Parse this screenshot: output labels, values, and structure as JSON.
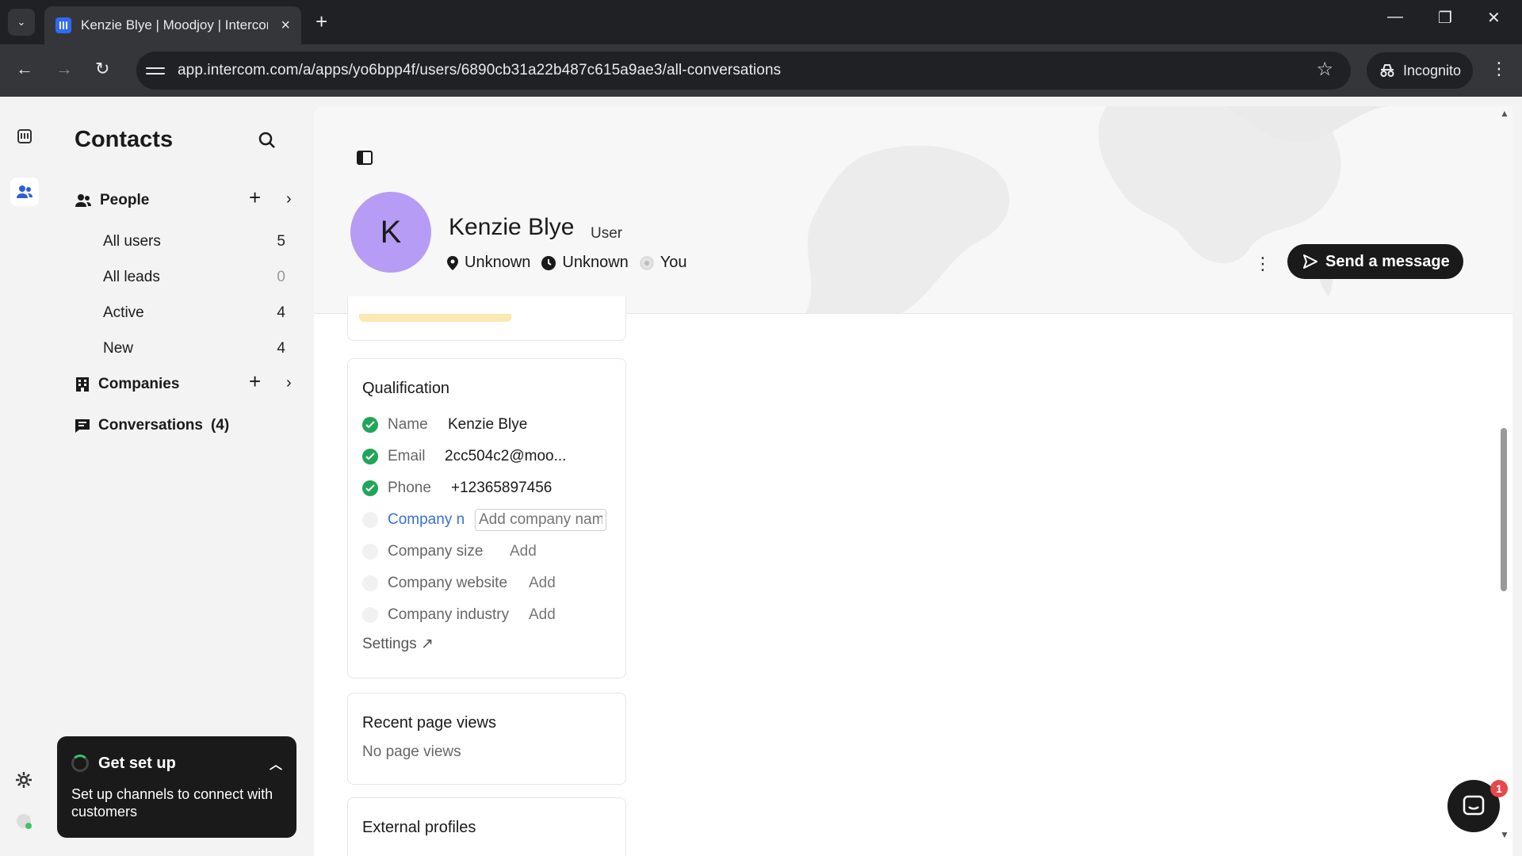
{
  "browser": {
    "tab_title": "Kenzie Blye | Moodjoy | Intercom",
    "url": "app.intercom.com/a/apps/yo6bpp4f/users/6890cb31a22b487c615a9ae3/all-conversations",
    "incognito_label": "Incognito"
  },
  "sidebar": {
    "title": "Contacts",
    "people_label": "People",
    "people_items": [
      {
        "label": "All users",
        "count": "5"
      },
      {
        "label": "All leads",
        "count": "0"
      },
      {
        "label": "Active",
        "count": "4"
      },
      {
        "label": "New",
        "count": "4"
      }
    ],
    "companies_label": "Companies",
    "conversations_label": "Conversations",
    "conversations_count": "(4)"
  },
  "get_set_up": {
    "title": "Get set up",
    "body": "Set up channels to connect with customers"
  },
  "contact": {
    "initial": "K",
    "name": "Kenzie Blye",
    "type": "User",
    "location": "Unknown",
    "local_time": "Unknown",
    "owner": "You",
    "send_button": "Send a message"
  },
  "qualification": {
    "title": "Qualification",
    "fields": [
      {
        "label": "Name",
        "value": "Kenzie Blye"
      },
      {
        "label": "Email",
        "value": "2cc504c2@moo..."
      },
      {
        "label": "Phone",
        "value": "+12365897456"
      }
    ],
    "company_name_label": "Company n",
    "company_name_placeholder": "Add company name",
    "empty_fields": [
      {
        "label": "Company size",
        "value": "Add"
      },
      {
        "label": "Company website",
        "value": "Add"
      },
      {
        "label": "Company industry",
        "value": "Add"
      }
    ],
    "settings_link": "Settings ↗"
  },
  "page_views": {
    "title": "Recent page views",
    "empty": "No page views"
  },
  "external_profiles": {
    "title": "External profiles"
  },
  "messenger": {
    "badge": "1"
  },
  "colors": {
    "avatar_bg": "#b79cf5",
    "check_green": "#22a559",
    "primary_button": "#1a1a1a",
    "badge_red": "#e5484d"
  }
}
